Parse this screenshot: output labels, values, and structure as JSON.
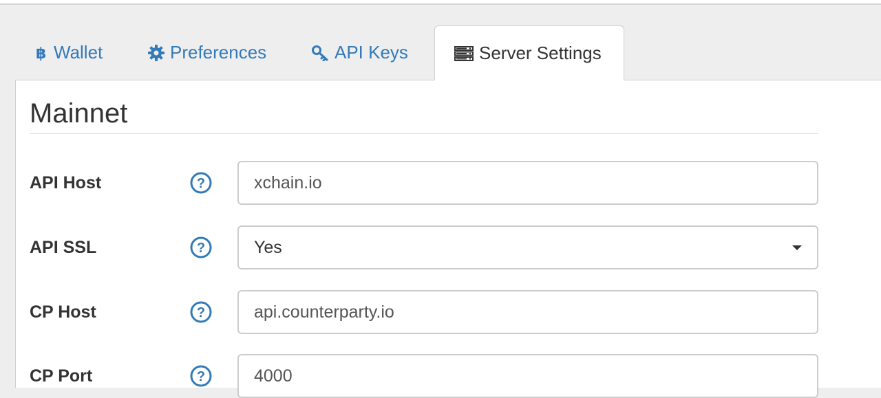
{
  "tabs": [
    {
      "label": "Wallet",
      "icon": "bitcoin-icon",
      "active": false
    },
    {
      "label": "Preferences",
      "icon": "gear-icon",
      "active": false
    },
    {
      "label": "API Keys",
      "icon": "key-icon",
      "active": false
    },
    {
      "label": "Server Settings",
      "icon": "server-icon",
      "active": true
    }
  ],
  "section": {
    "title": "Mainnet"
  },
  "fields": [
    {
      "label": "API Host",
      "value": "xchain.io",
      "type": "text"
    },
    {
      "label": "API SSL",
      "value": "Yes",
      "type": "select"
    },
    {
      "label": "CP Host",
      "value": "api.counterparty.io",
      "type": "text"
    },
    {
      "label": "CP Port",
      "value": "4000",
      "type": "text"
    }
  ],
  "colors": {
    "link": "#337ab7",
    "text": "#333333",
    "background": "#eeeeee"
  }
}
